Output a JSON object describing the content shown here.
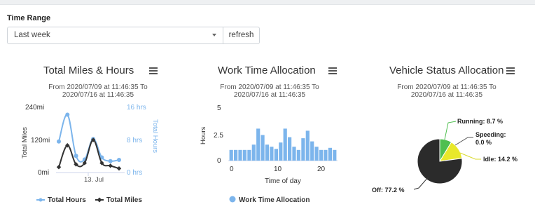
{
  "time_range": {
    "label": "Time Range",
    "selected": "Last week",
    "refresh_label": "refresh"
  },
  "charts": {
    "miles_hours": {
      "title": "Total Miles & Hours",
      "subtitle_line1": "From 2020/07/09 at 11:46:35 To",
      "subtitle_line2": "2020/07/16 at 11:46:35",
      "y_left_ticks": [
        "240mi",
        "120mi",
        "0mi"
      ],
      "y_right_ticks": [
        "16 hrs",
        "8 hrs",
        "0 hrs"
      ],
      "y_left_label": "Total Miles",
      "y_right_label": "Total Hours",
      "x_tick": "13. Jul",
      "legend_hours": "Total Hours",
      "legend_miles": "Total Miles"
    },
    "work_time": {
      "title": "Work Time Allocation",
      "subtitle_line1": "From 2020/07/09 at 11:46:35 To",
      "subtitle_line2": "2020/07/16 at 11:46:35",
      "y_ticks": [
        "5",
        "2.5",
        "0"
      ],
      "y_label": "Hours",
      "x_ticks": [
        "0",
        "10",
        "20"
      ],
      "x_label": "Time of day",
      "legend": "Work Time Allocation"
    },
    "vehicle_status": {
      "title": "Vehicle Status Allocation",
      "subtitle_line1": "From 2020/07/09 at 11:46:35 To",
      "subtitle_line2": "2020/07/16 at 11:46:35",
      "labels": {
        "running": "Running: 8.7 %",
        "speeding_1": "Speeding:",
        "speeding_2": "0.0 %",
        "idle": "Idle: 14.2 %",
        "off": "Off: 77.2 %"
      }
    }
  },
  "colors": {
    "hours": "#7cb5ec",
    "miles": "#333333",
    "bars": "#7cb5ec",
    "running": "#4fbf4f",
    "idle": "#e8e82a",
    "off": "#2b2b2b"
  },
  "chart_data": [
    {
      "type": "line",
      "title": "Total Miles & Hours",
      "xlabel": "",
      "ylabel": "Total Miles",
      "y2label": "Total Hours",
      "ylim": [
        0,
        240
      ],
      "y2lim": [
        0,
        16
      ],
      "x": [
        "2020-07-09",
        "2020-07-10",
        "2020-07-11",
        "2020-07-12",
        "2020-07-13",
        "2020-07-14",
        "2020-07-15",
        "2020-07-16"
      ],
      "series": [
        {
          "name": "Total Hours",
          "axis": "right",
          "values": [
            7.6,
            14.2,
            4.1,
            3.2,
            8.2,
            3.7,
            2.8,
            3.1
          ]
        },
        {
          "name": "Total Miles",
          "axis": "left",
          "values": [
            20,
            100,
            30,
            35,
            120,
            35,
            25,
            15
          ]
        }
      ],
      "legend": "bottom"
    },
    {
      "type": "bar",
      "title": "Work Time Allocation",
      "xlabel": "Time of day",
      "ylabel": "Hours",
      "ylim": [
        0,
        5
      ],
      "categories": [
        "0",
        "1",
        "2",
        "3",
        "4",
        "5",
        "6",
        "7",
        "8",
        "9",
        "10",
        "11",
        "12",
        "13",
        "14",
        "15",
        "16",
        "17",
        "18",
        "19",
        "20",
        "21",
        "22",
        "23"
      ],
      "values": [
        1.0,
        1.0,
        1.0,
        1.0,
        1.0,
        1.5,
        3.0,
        2.4,
        1.5,
        1.3,
        1.1,
        1.7,
        3.0,
        2.2,
        1.3,
        1.0,
        2.1,
        2.8,
        1.8,
        1.3,
        1.0,
        1.0,
        1.2,
        1.0
      ],
      "series_name": "Work Time Allocation",
      "legend": "bottom"
    },
    {
      "type": "pie",
      "title": "Vehicle Status Allocation",
      "slices": [
        {
          "name": "Running",
          "value": 8.7
        },
        {
          "name": "Speeding",
          "value": 0.0
        },
        {
          "name": "Idle",
          "value": 14.2
        },
        {
          "name": "Off",
          "value": 77.2
        }
      ]
    }
  ]
}
